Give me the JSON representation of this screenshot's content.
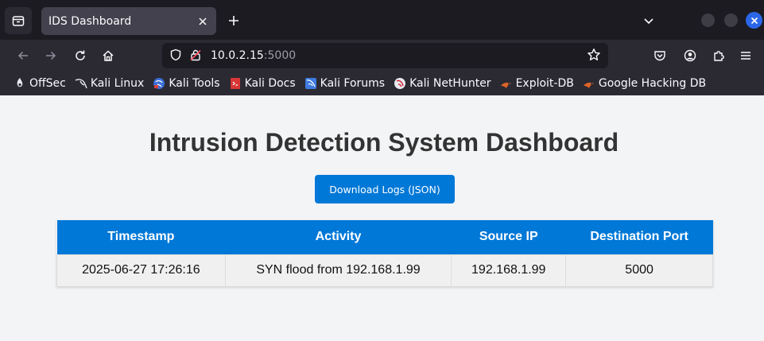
{
  "browser": {
    "tab": {
      "title": "IDS Dashboard"
    },
    "url": {
      "host": "10.0.2.15",
      "port": ":5000"
    },
    "bookmarks": [
      {
        "label": "OffSec",
        "icon": "offsec-icon"
      },
      {
        "label": "Kali Linux",
        "icon": "kali-dragon-icon"
      },
      {
        "label": "Kali Tools",
        "icon": "kali-tools-icon"
      },
      {
        "label": "Kali Docs",
        "icon": "kali-docs-icon"
      },
      {
        "label": "Kali Forums",
        "icon": "kali-forums-icon"
      },
      {
        "label": "Kali NetHunter",
        "icon": "nethunter-icon"
      },
      {
        "label": "Exploit-DB",
        "icon": "exploit-db-icon"
      },
      {
        "label": "Google Hacking DB",
        "icon": "ghdb-icon"
      }
    ]
  },
  "page": {
    "title": "Intrusion Detection System Dashboard",
    "download_label": "Download Logs (JSON)",
    "table": {
      "headers": [
        "Timestamp",
        "Activity",
        "Source IP",
        "Destination Port"
      ],
      "rows": [
        [
          "2025-06-27 17:26:16",
          "SYN flood from 192.168.1.99",
          "192.168.1.99",
          "5000"
        ]
      ]
    }
  },
  "colors": {
    "accent": "#0078d7",
    "heading": "#333333",
    "page_bg": "#f3f4f6",
    "chrome_dark": "#1c1b22",
    "chrome_bar": "#2b2a33"
  }
}
